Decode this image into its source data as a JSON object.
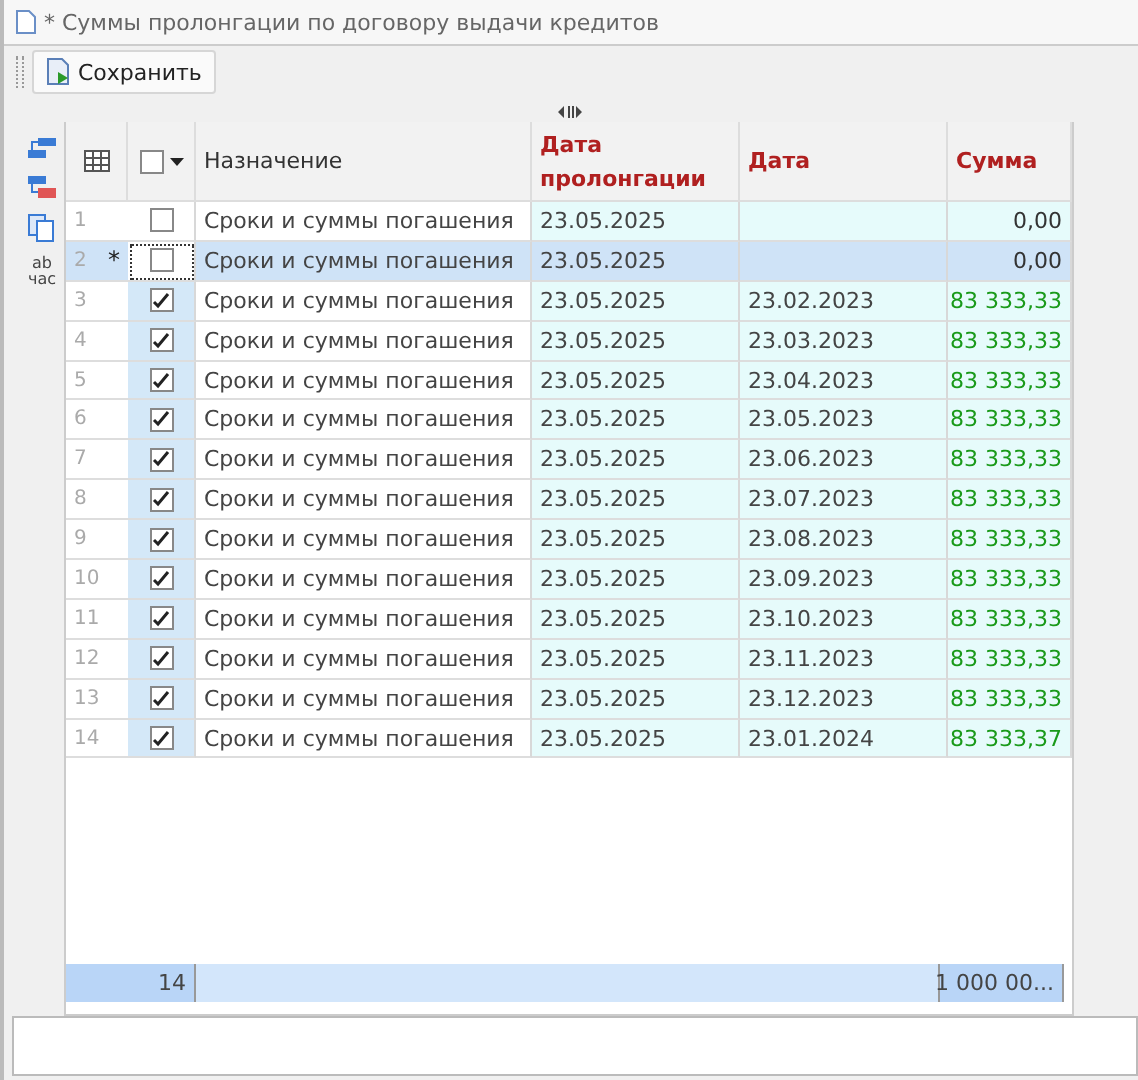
{
  "window": {
    "title": "* Суммы пролонгации по договору выдачи кредитов"
  },
  "toolbar": {
    "buttons": [
      {
        "label": "Сохранить"
      }
    ]
  },
  "side_tools": {
    "text_icon": {
      "top": "ab",
      "bottom": "час"
    }
  },
  "table": {
    "select_all": {
      "checked": false
    },
    "columns": [
      "Назначение",
      "Дата пролонгации",
      "Дата",
      "Сумма"
    ],
    "rows": [
      {
        "number": "1",
        "marker": "",
        "checked": false,
        "selected": false,
        "purpose": "Сроки и суммы погашения",
        "prolong_date": "23.05.2025",
        "date": "",
        "amount": "0,00",
        "color": "#333333"
      },
      {
        "number": "2",
        "marker": "*",
        "checked": false,
        "selected": true,
        "purpose": "Сроки и суммы погашения",
        "prolong_date": "23.05.2025",
        "date": "",
        "amount": "0,00",
        "color": "#333333"
      },
      {
        "number": "3",
        "marker": "",
        "checked": true,
        "selected": false,
        "purpose": "Сроки и суммы погашения",
        "prolong_date": "23.05.2025",
        "date": "23.02.2023",
        "amount": "83 333,33",
        "color": "#1a9a1a"
      },
      {
        "number": "4",
        "marker": "",
        "checked": true,
        "selected": false,
        "purpose": "Сроки и суммы погашения",
        "prolong_date": "23.05.2025",
        "date": "23.03.2023",
        "amount": "83 333,33",
        "color": "#1a9a1a"
      },
      {
        "number": "5",
        "marker": "",
        "checked": true,
        "selected": false,
        "purpose": "Сроки и суммы погашения",
        "prolong_date": "23.05.2025",
        "date": "23.04.2023",
        "amount": "83 333,33",
        "color": "#1a9a1a"
      },
      {
        "number": "6",
        "marker": "",
        "checked": true,
        "selected": false,
        "purpose": "Сроки и суммы погашения",
        "prolong_date": "23.05.2025",
        "date": "23.05.2023",
        "amount": "83 333,33",
        "color": "#1a9a1a"
      },
      {
        "number": "7",
        "marker": "",
        "checked": true,
        "selected": false,
        "purpose": "Сроки и суммы погашения",
        "prolong_date": "23.05.2025",
        "date": "23.06.2023",
        "amount": "83 333,33",
        "color": "#1a9a1a"
      },
      {
        "number": "8",
        "marker": "",
        "checked": true,
        "selected": false,
        "purpose": "Сроки и суммы погашения",
        "prolong_date": "23.05.2025",
        "date": "23.07.2023",
        "amount": "83 333,33",
        "color": "#1a9a1a"
      },
      {
        "number": "9",
        "marker": "",
        "checked": true,
        "selected": false,
        "purpose": "Сроки и суммы погашения",
        "prolong_date": "23.05.2025",
        "date": "23.08.2023",
        "amount": "83 333,33",
        "color": "#1a9a1a"
      },
      {
        "number": "10",
        "marker": "",
        "checked": true,
        "selected": false,
        "purpose": "Сроки и суммы погашения",
        "prolong_date": "23.05.2025",
        "date": "23.09.2023",
        "amount": "83 333,33",
        "color": "#1a9a1a"
      },
      {
        "number": "11",
        "marker": "",
        "checked": true,
        "selected": false,
        "purpose": "Сроки и суммы погашения",
        "prolong_date": "23.05.2025",
        "date": "23.10.2023",
        "amount": "83 333,33",
        "color": "#1a9a1a"
      },
      {
        "number": "12",
        "marker": "",
        "checked": true,
        "selected": false,
        "purpose": "Сроки и суммы погашения",
        "prolong_date": "23.05.2025",
        "date": "23.11.2023",
        "amount": "83 333,33",
        "color": "#1a9a1a"
      },
      {
        "number": "13",
        "marker": "",
        "checked": true,
        "selected": false,
        "purpose": "Сроки и суммы погашения",
        "prolong_date": "23.05.2025",
        "date": "23.12.2023",
        "amount": "83 333,33",
        "color": "#1a9a1a"
      },
      {
        "number": "14",
        "marker": "",
        "checked": true,
        "selected": false,
        "purpose": "Сроки и суммы погашения",
        "prolong_date": "23.05.2025",
        "date": "23.01.2024",
        "amount": "83 333,37",
        "color": "#1a9a1a"
      }
    ],
    "footer": {
      "count": "14",
      "total": "1 000 00..."
    }
  }
}
